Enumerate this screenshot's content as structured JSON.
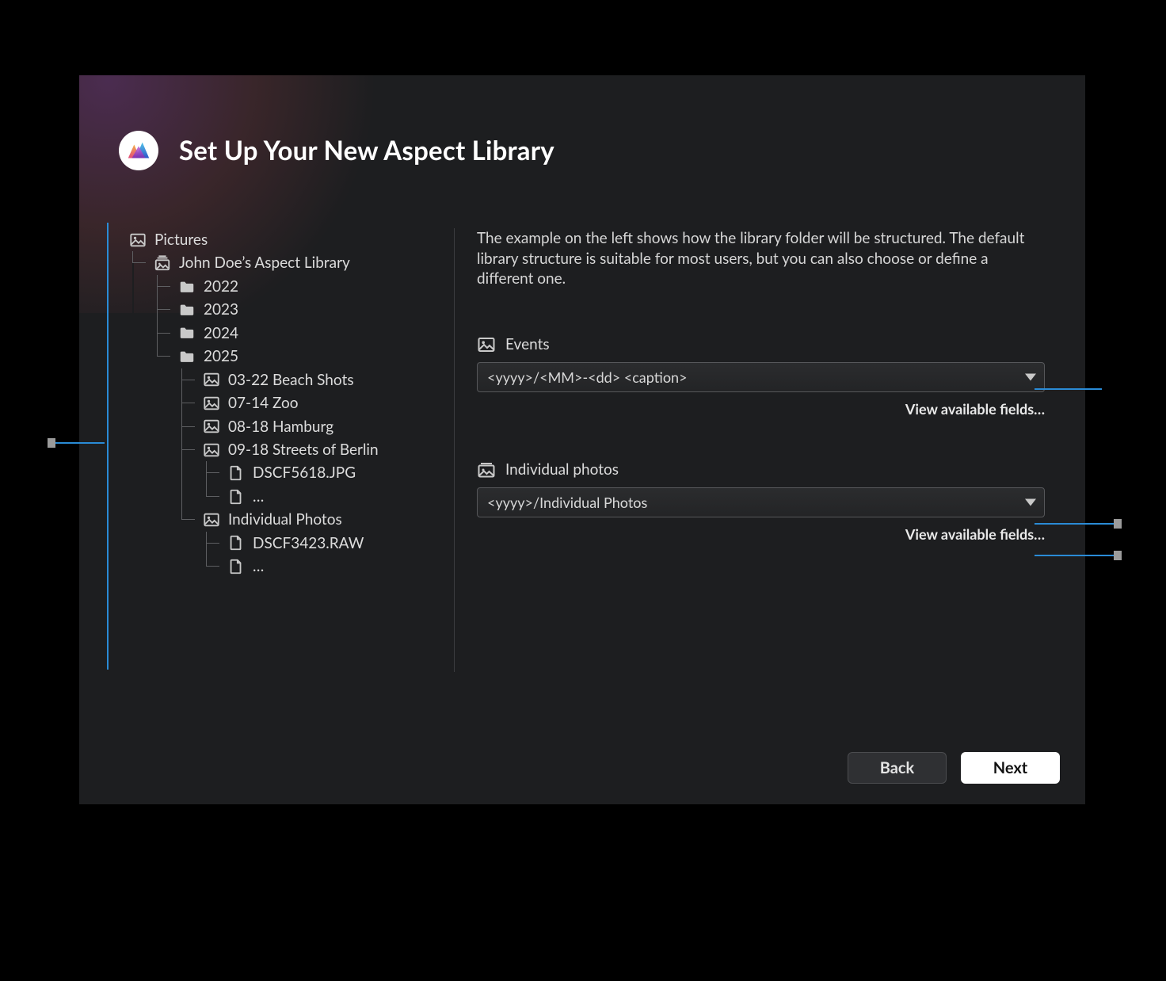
{
  "header": {
    "title": "Set Up Your New Aspect Library"
  },
  "tree": {
    "root": {
      "icon": "picture",
      "label": "Pictures"
    },
    "library": {
      "icon": "stack",
      "label": "John Doe’s Aspect Library"
    },
    "years": [
      "2022",
      "2023",
      "2024",
      "2025"
    ],
    "events": [
      "03-22 Beach Shots",
      "07-14 Zoo",
      "08-18 Hamburg",
      "09-18 Streets of Berlin"
    ],
    "event_files": [
      "DSCF5618.JPG",
      "…"
    ],
    "individual": {
      "label": "Individual Photos",
      "files": [
        "DSCF3423.RAW",
        "…"
      ]
    }
  },
  "right": {
    "intro": "The example on the left shows how the library folder will be structured. The default library structure is suitable for most users, but you can also choose or define a different one.",
    "events": {
      "label": "Events",
      "value": "<yyyy>/<MM>-<dd> <caption>",
      "link": "View available fields…"
    },
    "individual": {
      "label": "Individual photos",
      "value": "<yyyy>/Individual Photos",
      "link": "View available fields…"
    }
  },
  "footer": {
    "back": "Back",
    "next": "Next"
  }
}
